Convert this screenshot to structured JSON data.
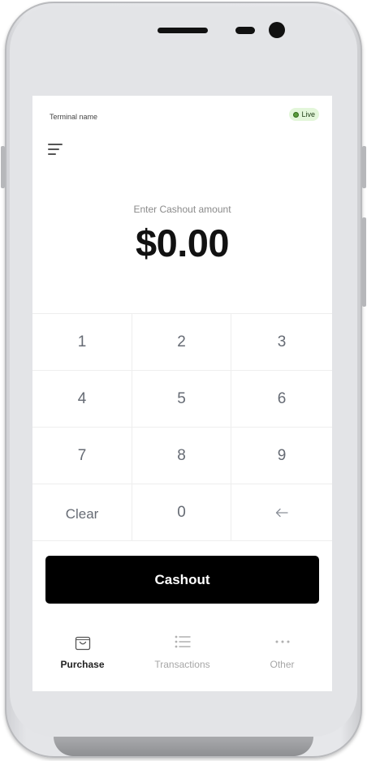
{
  "header": {
    "terminal_name": "Terminal name",
    "status_label": "Live"
  },
  "amount": {
    "label": "Enter Cashout amount",
    "value": "$0.00"
  },
  "keypad": {
    "keys": [
      "1",
      "2",
      "3",
      "4",
      "5",
      "6",
      "7",
      "8",
      "9",
      "Clear",
      "0",
      "←"
    ]
  },
  "action": {
    "cashout_label": "Cashout"
  },
  "nav": {
    "items": [
      {
        "label": "Purchase",
        "icon": "shopping-bag-icon",
        "active": true
      },
      {
        "label": "Transactions",
        "icon": "list-icon",
        "active": false
      },
      {
        "label": "Other",
        "icon": "more-dots-icon",
        "active": false
      }
    ]
  },
  "colors": {
    "live_badge_bg": "#e3f6da",
    "live_dot": "#5a9c3c",
    "primary_button": "#000000"
  }
}
